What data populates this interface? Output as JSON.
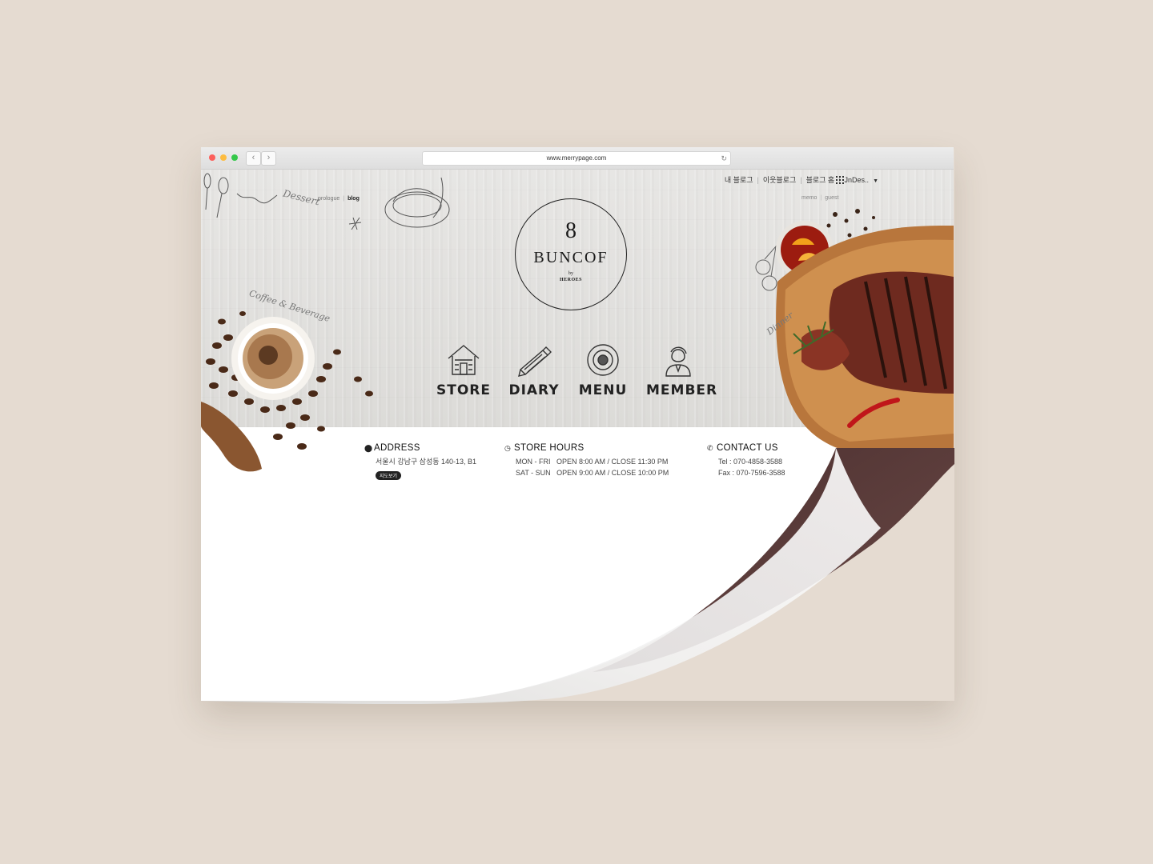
{
  "browser": {
    "url": "www.merrypage.com",
    "back_glyph": "‹",
    "forward_glyph": "›",
    "reload_glyph": "↻"
  },
  "topnav": {
    "my_blog": "내 블로그",
    "neighbor_blog": "이웃블로그",
    "blog_home": "블로그 홈",
    "user": "JnDes..",
    "dropdown_glyph": "▼"
  },
  "sublinks": {
    "memo": "memo",
    "guest": "guest"
  },
  "leftlinks": {
    "prologue": "prologue",
    "blog": "blog"
  },
  "logo": {
    "number": "8",
    "name": "BUNCOF",
    "by": "by",
    "subtitle": "HEROES"
  },
  "labels": {
    "dessert": "Dessert",
    "coffee": "Coffee & Beverage",
    "dinner": "Dinner"
  },
  "menu": {
    "store": "STORE",
    "diary": "DIARY",
    "menu": "MENU",
    "member": "MEMBER"
  },
  "info": {
    "address": {
      "icon": "map-pin-icon",
      "title": "ADDRESS",
      "line": "서울시 강남구 삼성동 140-13, B1",
      "map_button": "지도보기"
    },
    "hours": {
      "icon": "clock-icon",
      "title": "STORE HOURS",
      "weekday": "MON - FRI   OPEN 8:00 AM / CLOSE 11:30 PM",
      "weekend": "SAT - SUN   OPEN 9:00 AM / CLOSE 10:00 PM"
    },
    "contact": {
      "icon": "phone-icon",
      "title": "CONTACT US",
      "tel": "Tel : 070-4858-3588",
      "fax": "Fax : 070-7596-3588"
    }
  },
  "colors": {
    "background": "#e5dbd1",
    "page_curl": "#5a3c3c",
    "hero_wood": "#dcdbd8"
  }
}
